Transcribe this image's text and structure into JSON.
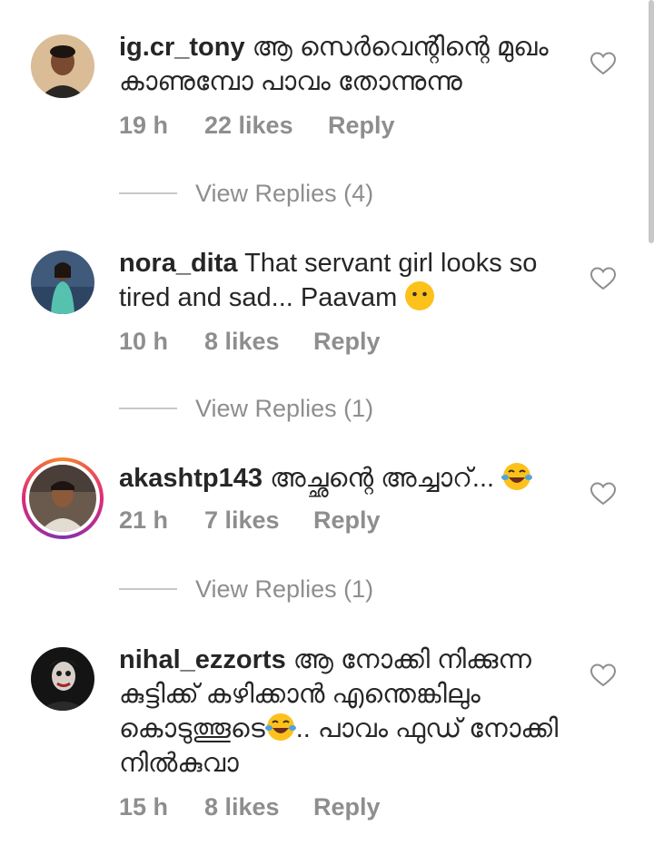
{
  "comments": [
    {
      "username": "ig.cr_tony",
      "text": "ആ സെർവെന്റിന്റെ മുഖം കാണുമ്പോ പാവം തോന്നുന്നു",
      "time": "19 h",
      "likes": "22 likes",
      "reply": "Reply",
      "view_replies": "View Replies (4)"
    },
    {
      "username": "nora_dita",
      "text": "That servant girl looks so tired and sad... Paavam",
      "time": "10 h",
      "likes": "8 likes",
      "reply": "Reply",
      "view_replies": "View Replies (1)"
    },
    {
      "username": "akashtp143",
      "text": "അച്ഛന്റെ അച്ചാറ്...",
      "time": "21 h",
      "likes": "7 likes",
      "reply": "Reply",
      "view_replies": "View Replies (1)"
    },
    {
      "username": "nihal_ezzorts",
      "text_part1": "ആ നോക്കി നിക്കുന്ന കുട്ടിക്ക് കഴിക്കാൻ എന്തെങ്കിലും കൊടുത്തൂടെ",
      "text_part2": ".. പാവം ഫുഡ് നോക്കി നിൽകുവാ",
      "time": "15 h",
      "likes": "8 likes",
      "reply": "Reply"
    }
  ],
  "icons": {
    "like": "heart-outline-icon",
    "emoji_neutral": "neutral-face-emoji",
    "emoji_laugh": "tears-of-joy-emoji"
  },
  "colors": {
    "text": "#262626",
    "meta": "#8e8e8e",
    "story_ring_start": "#f58529",
    "story_ring_end": "#dd2a7b"
  }
}
